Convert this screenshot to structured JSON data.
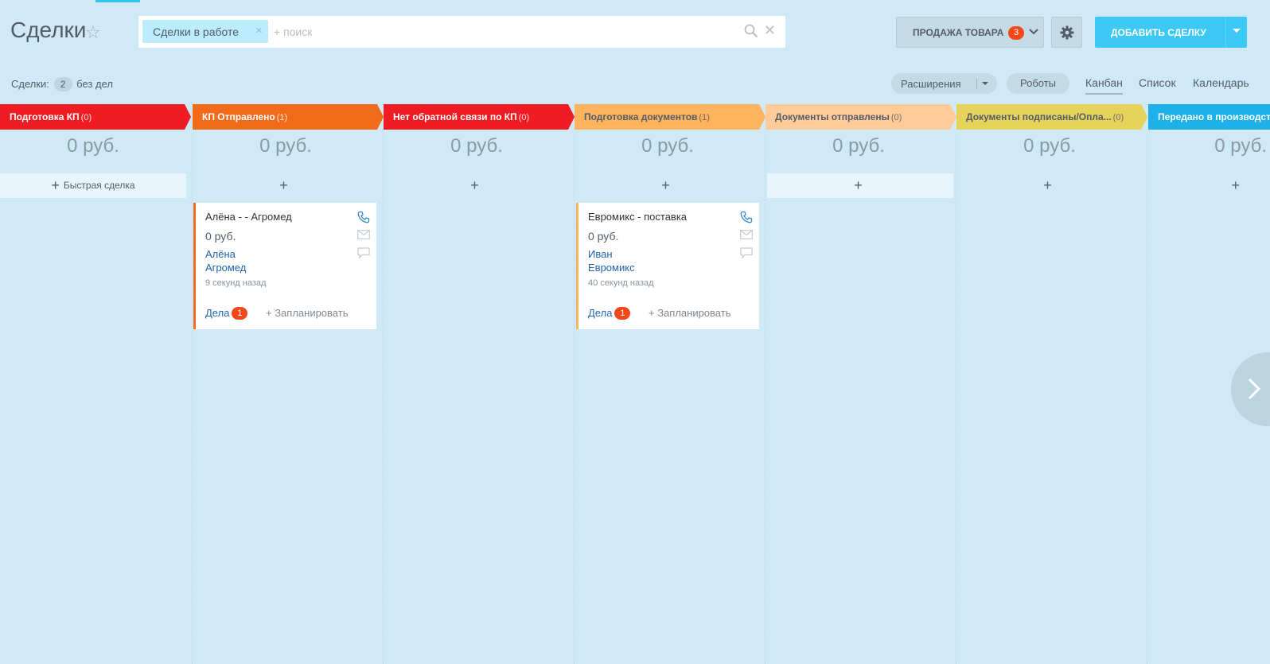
{
  "header": {
    "title": "Сделки",
    "filter_tag": "Сделки в работе",
    "search_placeholder": "+ поиск",
    "category": {
      "label": "ПРОДАЖА ТОВАРА",
      "count": "3"
    },
    "add_deal_label": "ДОБАВИТЬ СДЕЛКУ"
  },
  "subheader": {
    "deals_label": "Сделки:",
    "deals_count": "2",
    "deals_suffix": "без дел",
    "extensions_label": "Расширения",
    "robots_label": "Роботы",
    "views": [
      "Канбан",
      "Список",
      "Календарь"
    ]
  },
  "stages": [
    {
      "name": "Подготовка КП",
      "count": "(0)",
      "color": "#f01c23",
      "sum": "0 руб.",
      "add": "Быстрая сделка"
    },
    {
      "name": "КП Отправлено",
      "count": "(1)",
      "color": "#f26b1a",
      "sum": "0 руб.",
      "add": ""
    },
    {
      "name": "Нет обратной связи по КП",
      "count": "(0)",
      "color": "#f01c23",
      "sum": "0 руб.",
      "add": ""
    },
    {
      "name": "Подготовка документов",
      "count": "(1)",
      "color": "#ffb35c",
      "sum": "0 руб.",
      "add": ""
    },
    {
      "name": "Документы отправлены",
      "count": "(0)",
      "color": "#ffcc99",
      "sum": "0 руб.",
      "add": ""
    },
    {
      "name": "Документы подписаны/Опла...",
      "count": "(0)",
      "color": "#e6d35a",
      "sum": "0 руб.",
      "add": ""
    },
    {
      "name": "Передано в производст",
      "count": "",
      "color": "#1eb0e8",
      "sum": "0 руб.",
      "add": ""
    }
  ],
  "cards": [
    {
      "title": "Алёна - - Агромед",
      "price": "0 руб.",
      "contact": "Алёна",
      "company": "Агромед",
      "time": "9 секунд назад",
      "activities_label": "Дела",
      "activities_count": "1",
      "plan_label": "+ Запланировать"
    },
    {
      "title": "Евромикс - поставка",
      "price": "0 руб.",
      "contact": "Иван",
      "company": "Евромикс",
      "time": "40 секунд назад",
      "activities_label": "Дела",
      "activities_count": "1",
      "plan_label": "+ Запланировать"
    }
  ],
  "icons": {
    "favorite": "star-icon",
    "search": "search-icon",
    "clear": "close-icon",
    "settings": "gear-icon",
    "phone": "phone-icon",
    "mail": "mail-icon",
    "chat": "chat-icon",
    "next": "chevron-right-icon"
  }
}
